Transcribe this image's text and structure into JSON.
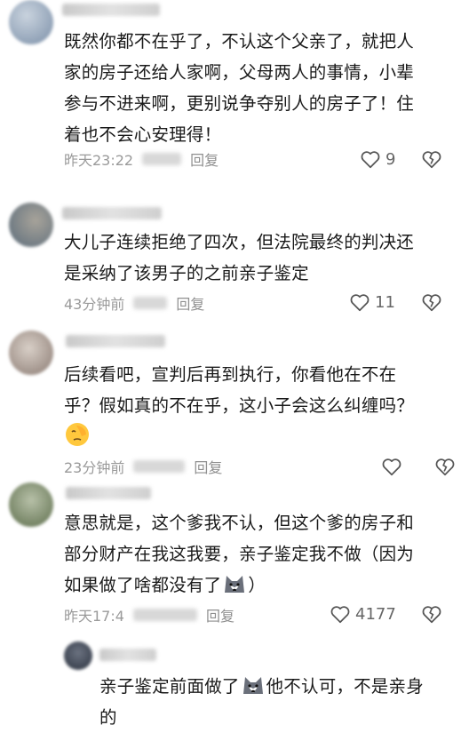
{
  "comments": [
    {
      "text_lines": [
        "既然你都不在乎了，不认这个父亲了，就把人",
        "家的房子还给人家啊，父母两人的事情，小辈",
        "参与不进来啊，更别说争夺别人的房子了！住",
        "着也不会心安理得！"
      ],
      "time": "昨天23:22",
      "reply": "回复",
      "likes": "9",
      "avatar_colors": [
        "#7b8fa8",
        "#c9d3de"
      ]
    },
    {
      "text_lines": [
        "大儿子连续拒绝了四次，但法院最终的判决还",
        "是采纳了该男子的之前亲子鉴定"
      ],
      "time": "43分钟前",
      "reply": "回复",
      "likes": "11",
      "avatar_colors": [
        "#5a6b7a",
        "#a7a39a"
      ]
    },
    {
      "text_lines": [
        "后续看吧，宣判后再到执行，你看他在不在",
        "乎？假如真的不在乎，这小子会这么纠缠吗？"
      ],
      "emoji": "facepalm-emoji",
      "time": "23分钟前",
      "reply": "回复",
      "likes": "",
      "avatar_colors": [
        "#8a7a72",
        "#d8cfc7"
      ]
    },
    {
      "text_lines": [
        "意思就是，这个爹我不认，但这个爹的房子和",
        "部分财产在我这我要，亲子鉴定我不做（因为",
        "如果做了啥都没有了",
        "）"
      ],
      "emoji": "husky-emoji",
      "time": "昨天17:4",
      "reply": "回复",
      "likes": "4177",
      "avatar_colors": [
        "#5d6e4c",
        "#b7c0a8"
      ]
    },
    {
      "text_lines": [
        "亲子鉴定前面做了",
        "他不认可，不是亲身",
        "的"
      ],
      "emoji": "husky-emoji",
      "avatar_colors": [
        "#2c3340",
        "#6b7280"
      ]
    }
  ],
  "colors": {
    "icon": "#555555",
    "meta": "#9a9a9a",
    "text": "#1a1a1a"
  }
}
